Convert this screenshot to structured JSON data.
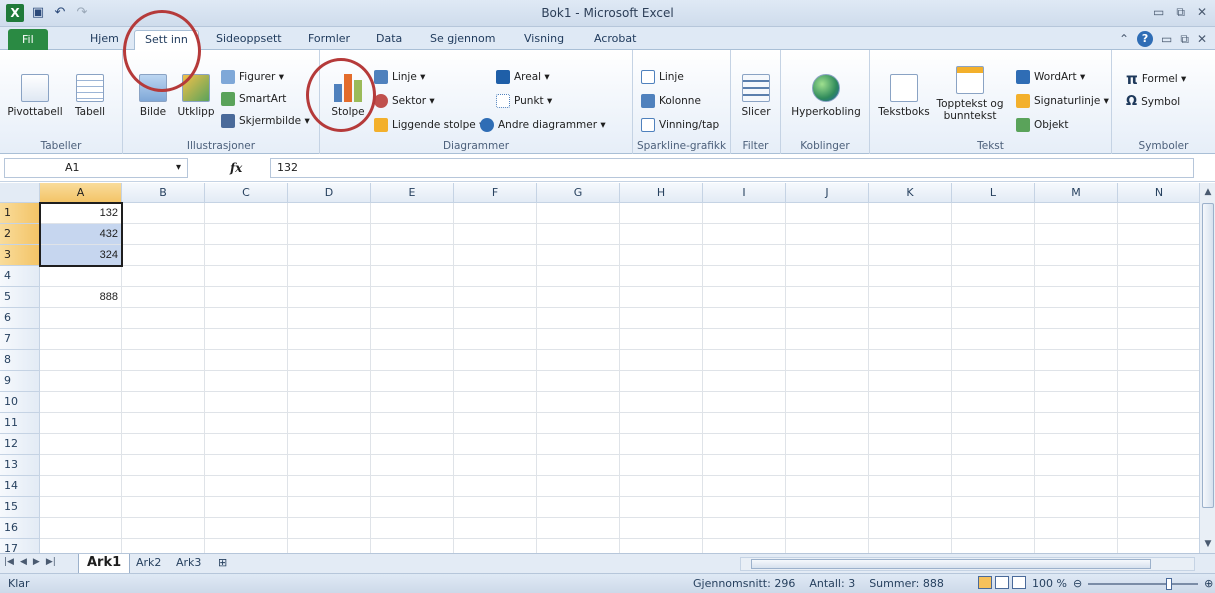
{
  "window": {
    "title": "Bok1  -  Microsoft Excel"
  },
  "tabs": [
    {
      "label": "Fil"
    },
    {
      "label": "Hjem"
    },
    {
      "label": "Sett inn"
    },
    {
      "label": "Sideoppsett"
    },
    {
      "label": "Formler"
    },
    {
      "label": "Data"
    },
    {
      "label": "Se gjennom"
    },
    {
      "label": "Visning"
    },
    {
      "label": "Acrobat"
    }
  ],
  "ribbon": {
    "tabeller": {
      "pivottabell": "Pivottabell",
      "tabell": "Tabell",
      "group": "Tabeller"
    },
    "illustrasjoner": {
      "bilde": "Bilde",
      "utklipp": "Utklipp",
      "figurer": "Figurer ▾",
      "smartart": "SmartArt",
      "skjermbilde": "Skjermbilde ▾",
      "group": "Illustrasjoner"
    },
    "diagrammer": {
      "stolpe": "Stolpe",
      "linje": "Linje ▾",
      "sektor": "Sektor ▾",
      "liggende": "Liggende stolpe ▾",
      "areal": "Areal ▾",
      "punkt": "Punkt ▾",
      "andre": "Andre diagrammer ▾",
      "group": "Diagrammer"
    },
    "sparkline": {
      "linje": "Linje",
      "kolonne": "Kolonne",
      "vinning": "Vinning/tap",
      "group": "Sparkline-grafikk"
    },
    "filter": {
      "slicer": "Slicer",
      "group": "Filter"
    },
    "koblinger": {
      "hyperkobling": "Hyperkobling",
      "group": "Koblinger"
    },
    "tekst": {
      "tekstboks": "Tekstboks",
      "topptekst1": "Topptekst og",
      "topptekst2": "bunntekst",
      "wordart": "WordArt ▾",
      "signatur": "Signaturlinje ▾",
      "objekt": "Objekt",
      "group": "Tekst"
    },
    "symboler": {
      "formel": "Formel ▾",
      "symbol": "Symbol",
      "group": "Symboler"
    }
  },
  "formula_bar": {
    "name_box": "A1",
    "fx": "fx",
    "value": "132"
  },
  "columns": [
    "A",
    "B",
    "C",
    "D",
    "E",
    "F",
    "G",
    "H",
    "I",
    "J",
    "K",
    "L",
    "M",
    "N"
  ],
  "rows": [
    "1",
    "2",
    "3",
    "4",
    "5",
    "6",
    "7",
    "8",
    "9",
    "10",
    "11",
    "12",
    "13",
    "14",
    "15",
    "16",
    "17"
  ],
  "cells": {
    "A1": "132",
    "A2": "432",
    "A3": "324",
    "A5": "888"
  },
  "sheets": [
    {
      "label": "Ark1"
    },
    {
      "label": "Ark2"
    },
    {
      "label": "Ark3"
    }
  ],
  "status": {
    "ready": "Klar",
    "average": "Gjennomsnitt: 296",
    "count": "Antall: 3",
    "sum": "Summer: 888",
    "zoom": "100 %"
  }
}
